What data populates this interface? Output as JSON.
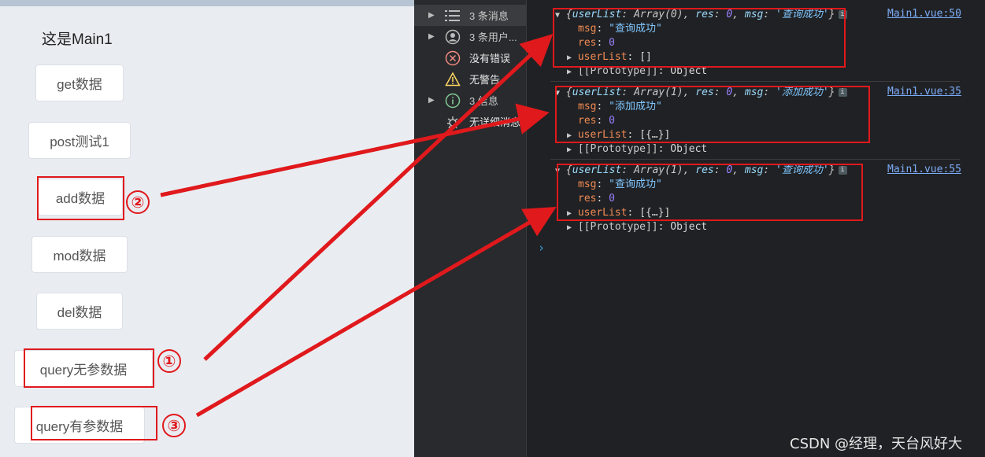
{
  "app": {
    "title": "这是Main1",
    "buttons": {
      "get": "get数据",
      "post": "post测试1",
      "add": "add数据",
      "mod": "mod数据",
      "del": "del数据",
      "query_noparam": "query无参数据",
      "query_param": "query有参数据"
    }
  },
  "sidebar": {
    "items": [
      {
        "label": "3 条消息",
        "icon": "list-icon",
        "active": true
      },
      {
        "label": "3 条用户...",
        "icon": "user-icon"
      },
      {
        "label": "没有错误",
        "icon": "error-icon"
      },
      {
        "label": "无警告",
        "icon": "warning-icon"
      },
      {
        "label": "3 信息",
        "icon": "info-icon"
      },
      {
        "label": "无详细消息",
        "icon": "verbose-icon"
      }
    ]
  },
  "console": {
    "logs": [
      {
        "summary_userList": "userList",
        "summary_array": "Array(0)",
        "summary_res_key": "res",
        "summary_res": "0",
        "summary_msg_key": "msg",
        "summary_msg": "'查询成功'",
        "source": "Main1.vue:50",
        "msg_key": "msg",
        "msg_val": "\"查询成功\"",
        "res_key": "res",
        "res_val": "0",
        "userList_key": "userList",
        "userList_val": "[]",
        "proto": "[[Prototype]]",
        "proto_val": "Object"
      },
      {
        "summary_userList": "userList",
        "summary_array": "Array(1)",
        "summary_res_key": "res",
        "summary_res": "0",
        "summary_msg_key": "msg",
        "summary_msg": "'添加成功'",
        "source": "Main1.vue:35",
        "msg_key": "msg",
        "msg_val": "\"添加成功\"",
        "res_key": "res",
        "res_val": "0",
        "userList_key": "userList",
        "userList_val": "[{…}]",
        "proto": "[[Prototype]]",
        "proto_val": "Object"
      },
      {
        "summary_userList": "userList",
        "summary_array": "Array(1)",
        "summary_res_key": "res",
        "summary_res": "0",
        "summary_msg_key": "msg",
        "summary_msg": "'查询成功'",
        "source": "Main1.vue:55",
        "msg_key": "msg",
        "msg_val": "\"查询成功\"",
        "res_key": "res",
        "res_val": "0",
        "userList_key": "userList",
        "userList_val": "[{…}]",
        "proto": "[[Prototype]]",
        "proto_val": "Object"
      }
    ],
    "prompt": "›"
  },
  "annotations": {
    "markers": [
      "①",
      "②",
      "③"
    ],
    "color": "#e0191c"
  },
  "watermark": "CSDN @经理，天台风好大"
}
